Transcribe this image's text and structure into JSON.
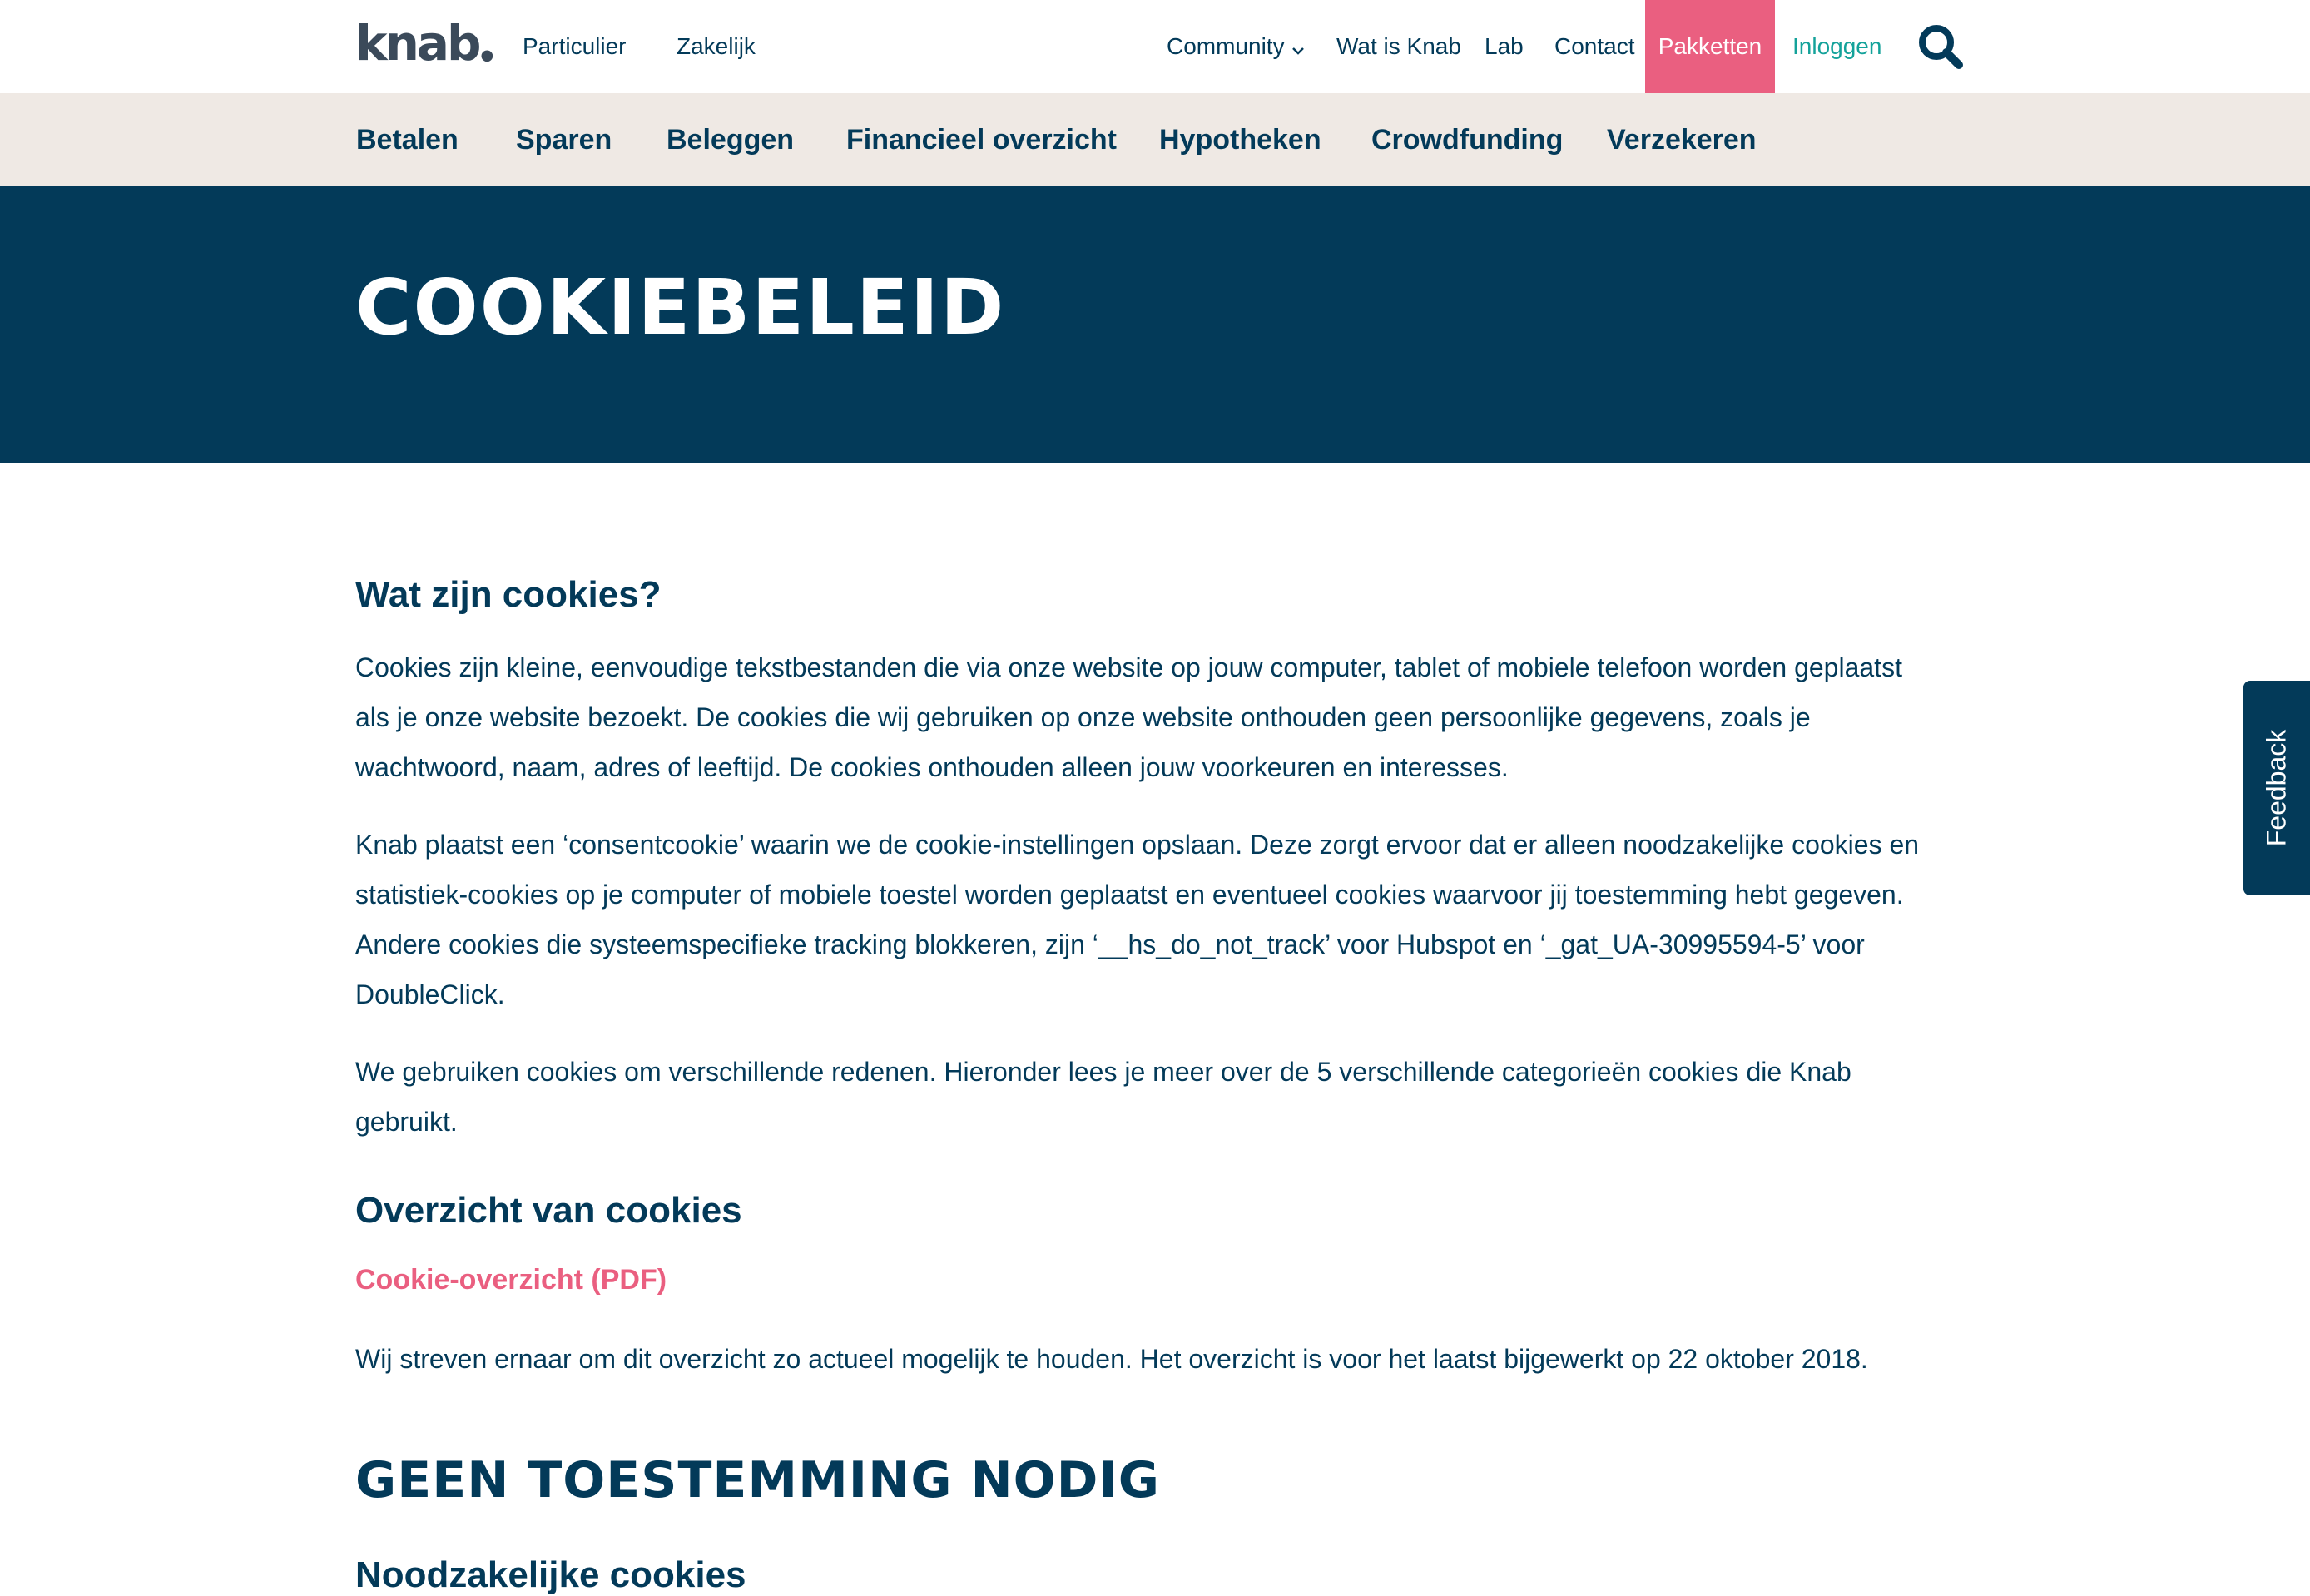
{
  "header": {
    "logo": "knab",
    "top_links": {
      "particulier": "Particulier",
      "zakelijk": "Zakelijk",
      "community": "Community",
      "wat_is_knab": "Wat is Knab",
      "lab": "Lab",
      "contact": "Contact",
      "pakketten": "Pakketten",
      "inloggen": "Inloggen"
    },
    "icons": {
      "community": "chevron-down-icon",
      "search": "search-icon"
    }
  },
  "subnav": {
    "items": [
      "Betalen",
      "Sparen",
      "Beleggen",
      "Financieel overzicht",
      "Hypotheken",
      "Crowdfunding",
      "Verzekeren"
    ]
  },
  "hero": {
    "title": "COOKIEBELEID"
  },
  "main": {
    "h_wat": "Wat zijn cookies?",
    "p1": "Cookies zijn kleine, eenvoudige tekstbestanden die via onze website op jouw computer, tablet of mobiele telefoon worden geplaatst als je onze website bezoekt. De cookies die wij gebruiken op onze website onthouden geen persoonlijke gegevens, zoals je wachtwoord, naam, adres of leeftijd. De cookies onthouden alleen jouw voorkeuren en interesses.",
    "p2": "Knab plaatst een ‘consentcookie’ waarin we de cookie-instellingen opslaan. Deze zorgt ervoor dat er alleen noodzakelijke cookies en statistiek-cookies op je computer of mobiele toestel worden geplaatst en eventueel cookies waarvoor jij toestemming hebt gegeven. Andere cookies die systeemspecifieke tracking blokkeren, zijn ‘__hs_do_not_track’ voor Hubspot en ‘_gat_UA-30995594-5’ voor DoubleClick.",
    "p3": "We gebruiken cookies om verschillende redenen. Hieronder lees je meer over de 5 verschillende categorieën cookies die Knab gebruikt.",
    "h_overzicht": "Overzicht van cookies",
    "pdf_link": "Cookie-overzicht (PDF)",
    "p4": "Wij streven ernaar om dit overzicht zo actueel mogelijk te houden. Het overzicht is voor het laatst bijgewerkt op 22 oktober 2018.",
    "h_geen": "GEEN TOESTEMMING NODIG",
    "h_noodzakelijk": "Noodzakelijke cookies"
  },
  "feedback": {
    "label": "Feedback"
  },
  "colors": {
    "navy": "#033a59",
    "pink": "#ea5f80",
    "teal": "#14a29a",
    "beige": "#efe9e4",
    "logo_gray": "#3b4a5a"
  }
}
